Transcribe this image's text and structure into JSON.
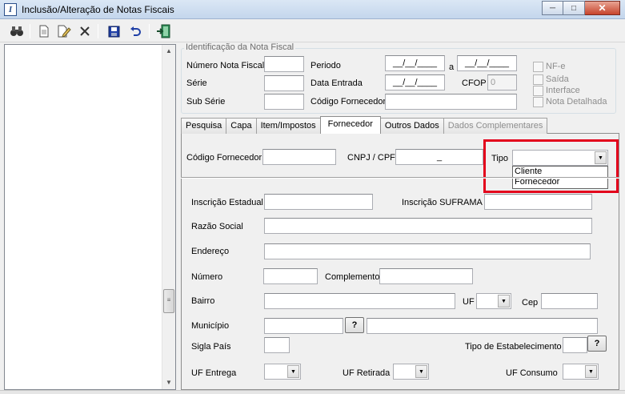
{
  "window": {
    "title": "Inclusão/Alteração de Notas Fiscais"
  },
  "identificacao": {
    "title": "Identificação da Nota Fiscal",
    "numero_label": "Número Nota Fiscal",
    "periodo_label": "Periodo",
    "periodo_start": "__/__/____",
    "periodo_a": "a",
    "periodo_end": "__/__/____",
    "serie_label": "Série",
    "data_entrada_label": "Data Entrada",
    "data_entrada_value": "__/__/____",
    "cfop_label": "CFOP",
    "cfop_value": "0",
    "sub_serie_label": "Sub Série",
    "codigo_fornecedor_label": "Código Fornecedor",
    "checks": [
      "NF-e",
      "Saída",
      "Interface",
      "Nota Detalhada"
    ]
  },
  "tabs": [
    {
      "label": "Pesquisa"
    },
    {
      "label": "Capa"
    },
    {
      "label": "Item/Impostos"
    },
    {
      "label": "Fornecedor"
    },
    {
      "label": "Outros Dados"
    },
    {
      "label": "Dados Complementares"
    }
  ],
  "fornecedor": {
    "codigo_label": "Código Fornecedor",
    "cnpj_label": "CNPJ / CPF",
    "cnpj_value": "_",
    "tipo_label": "Tipo",
    "tipo_options": [
      "Cliente",
      "Fornecedor"
    ],
    "inscricao_estadual_label": "Inscrição Estadual",
    "inscricao_suframa_label": "Inscrição SUFRAMA",
    "razao_social_label": "Razão Social",
    "endereco_label": "Endereço",
    "numero_label": "Número",
    "complemento_label": "Complemento",
    "bairro_label": "Bairro",
    "uf_label": "UF",
    "cep_label": "Cep",
    "municipio_label": "Município",
    "sigla_pais_label": "Sigla País",
    "tipo_estabelecimento_label": "Tipo de Estabelecimento",
    "uf_entrega_label": "UF Entrega",
    "uf_retirada_label": "UF Retirada",
    "uf_consumo_label": "UF Consumo",
    "lookup_label": "?"
  }
}
